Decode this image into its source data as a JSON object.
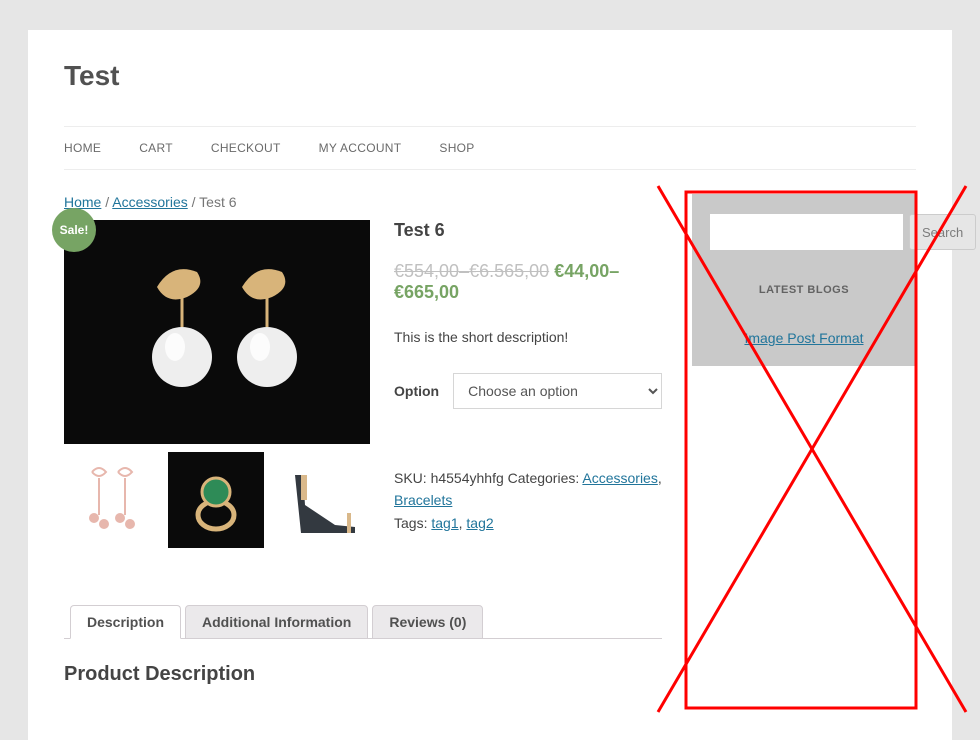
{
  "site": {
    "title": "Test"
  },
  "nav": {
    "items": [
      {
        "label": "HOME"
      },
      {
        "label": "CART"
      },
      {
        "label": "CHECKOUT"
      },
      {
        "label": "MY ACCOUNT"
      },
      {
        "label": "SHOP"
      }
    ]
  },
  "breadcrumb": {
    "home": "Home",
    "sep": " / ",
    "cat": "Accessories",
    "current": "Test 6"
  },
  "product": {
    "sale_badge": "Sale!",
    "title": "Test 6",
    "price_old_low": "€554,00",
    "price_dash": "–",
    "price_old_high": "€6.565,00",
    "price_new_low": "€44,00",
    "price_new_high": "€665,00",
    "short_description": "This is the short description!",
    "option_label": "Option",
    "option_placeholder": "Choose an option",
    "sku_label": "SKU: ",
    "sku": "h4554yhhfg",
    "categories_label": " Categories: ",
    "cat1": "Accessories",
    "cat2": "Bracelets",
    "tags_label": "Tags: ",
    "tag1": "tag1",
    "tag2": "tag2",
    "comma": ", "
  },
  "tabs": {
    "items": [
      {
        "label": "Description"
      },
      {
        "label": "Additional Information"
      },
      {
        "label": "Reviews (0)"
      }
    ],
    "description_heading": "Product Description"
  },
  "sidebar": {
    "search_button": "Search",
    "widget_title": "LATEST BLOGS",
    "link1": "Image Post Format"
  }
}
